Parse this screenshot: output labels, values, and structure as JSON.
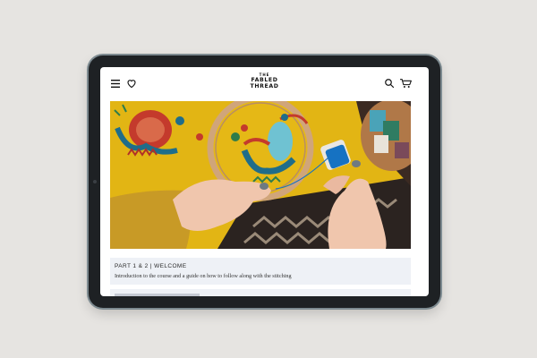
{
  "header": {
    "logo_line1": "THE",
    "logo_line2": "FABLED",
    "logo_line3": "THREAD"
  },
  "lessons": [
    {
      "title": "PART 1 & 2 | WELCOME",
      "description": "Introduction to the course and a guide on how to follow along with the stitching"
    }
  ],
  "colors": {
    "background": "#e6e4e1",
    "tablet_bezel": "#1e2124",
    "lesson_card": "#eef1f6",
    "hero_yellow": "#e2b514"
  },
  "icons": [
    "menu-icon",
    "heart-icon",
    "search-icon",
    "cart-icon"
  ]
}
